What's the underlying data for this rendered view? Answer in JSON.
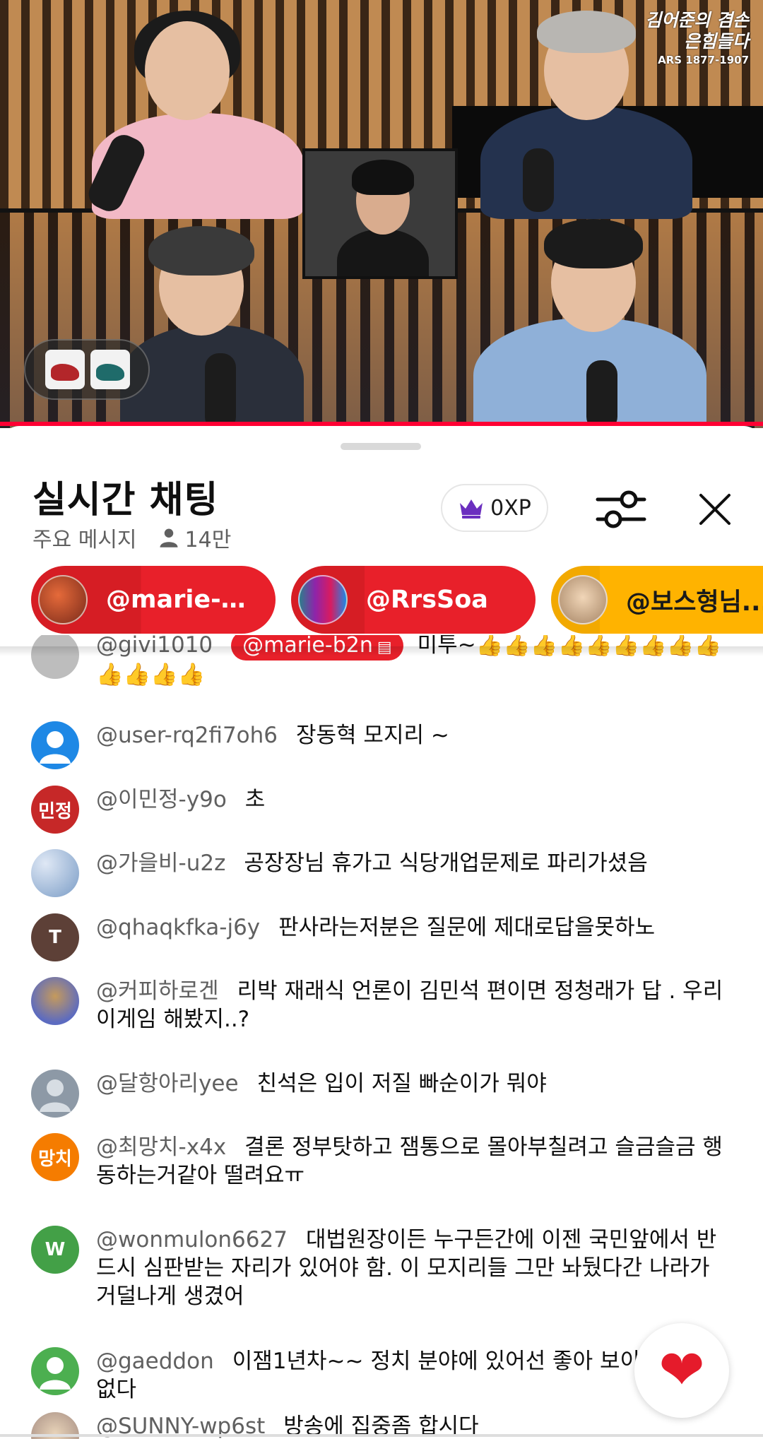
{
  "video": {
    "logo_line1": "김어준의 겸손은힘들다",
    "logo_line2": "ARS 1877-1907"
  },
  "chat": {
    "title": "실시간 채팅",
    "filter_label": "주요 메시지",
    "viewer_count": "14만",
    "xp_label": "0XP",
    "pinned": [
      {
        "name": "@marie-b...",
        "color": "#e8202a"
      },
      {
        "name": "@RrsSoa",
        "color": "#e8202a"
      },
      {
        "name": "@보스형님...",
        "color": "#ffb300"
      }
    ],
    "messages": [
      {
        "author": "@givi1010",
        "mention": "@marie-b2n",
        "text": "미투~👍👍👍👍👍👍👍👍👍👍👍👍👍",
        "avatar_text": "",
        "avatar_color": "#bdbdbd"
      },
      {
        "author": "@user-rq2fi7oh6",
        "text": "장동혁 모지리 ~",
        "avatar_text": "",
        "avatar_color": "#1e88e5"
      },
      {
        "author": "@이민정-y9o",
        "text": "초",
        "avatar_text": "민정",
        "avatar_color": "#c62828"
      },
      {
        "author": "@가을비-u2z",
        "text": "공장장님 휴가고 식당개업문제로 파리가셨음",
        "avatar_text": "",
        "avatar_color": "#7a9cc6"
      },
      {
        "author": "@qhaqkfka-j6y",
        "text": "판사라는저분은 질문에 제대로답을못하노",
        "avatar_text": "T",
        "avatar_color": "#5d4037"
      },
      {
        "author": "@커피하로겐",
        "text": "리박 재래식 언론이 김민석 편이면 정청래가 답 . 우리 이게임 해봤지..?",
        "avatar_text": "",
        "avatar_color": "#5c6bc0"
      },
      {
        "author": "@달항아리yee",
        "text": "친석은 입이 저질 빠순이가 뭐야",
        "avatar_text": "",
        "avatar_color": "#8d99a6"
      },
      {
        "author": "@최망치-x4x",
        "text": "결론 정부탓하고 잼통으로 몰아부칠려고 슬금슬금 행동하는거같아 떨려요ㅠ",
        "avatar_text": "망치",
        "avatar_color": "#f57c00"
      },
      {
        "author": "@wonmulon6627",
        "text": "대법원장이든 누구든간에 이젠 국민앞에서 반드시 심판받는 자리가 있어야 함. 이 모지리들 그만 놔뒀다간 나라가 거덜나게 생겼어",
        "avatar_text": "W",
        "avatar_color": "#43a047"
      },
      {
        "author": "@gaeddon",
        "text": "이잼1년차~~ 정치 분야에 있어선 좋아 보이는게 없다",
        "avatar_text": "",
        "avatar_color": "#4caf50"
      },
      {
        "author": "@SUNNY-wp6st",
        "text": "방송에 집중좀 합시다",
        "avatar_text": "",
        "avatar_color": "#a1887f"
      }
    ]
  },
  "fab": {
    "icon": "heart-icon",
    "color": "#e51b2b"
  }
}
